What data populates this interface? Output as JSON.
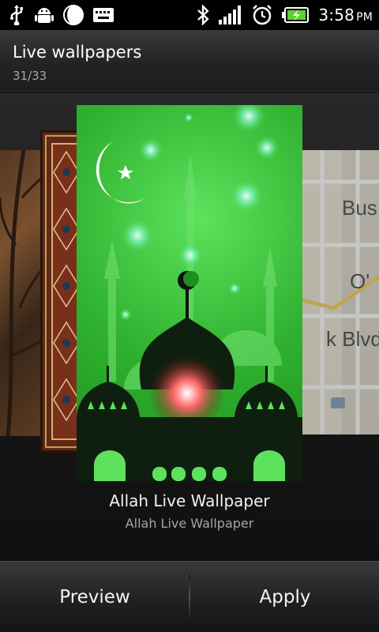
{
  "status_bar": {
    "time": "3:58",
    "ampm": "PM",
    "icons_left": [
      "usb-icon",
      "android-debug-icon",
      "moon-icon",
      "keyboard-icon"
    ],
    "icons_right": [
      "bluetooth-icon",
      "signal-icon",
      "alarm-icon",
      "battery-charging-icon"
    ]
  },
  "header": {
    "title": "Live wallpapers",
    "position": "31/33"
  },
  "carousel": {
    "selected": {
      "name": "Allah Live Wallpaper",
      "subtitle": "Allah Live Wallpaper"
    },
    "map_labels": [
      "Bus",
      "O'",
      "k Blvd"
    ]
  },
  "actions": {
    "preview_label": "Preview",
    "apply_label": "Apply"
  },
  "colors": {
    "accent_green": "#2fb22f",
    "background": "#151515"
  }
}
